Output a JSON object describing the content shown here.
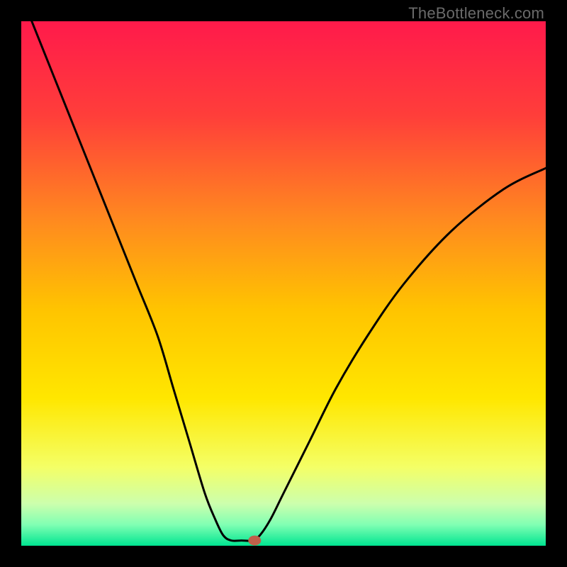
{
  "watermark": "TheBottleneck.com",
  "chart_data": {
    "type": "line",
    "title": "",
    "xlabel": "",
    "ylabel": "",
    "xlim": [
      0,
      100
    ],
    "ylim": [
      0,
      100
    ],
    "legend": false,
    "grid": false,
    "background_gradient_stops": [
      {
        "offset": 0.0,
        "color": "#ff1a4b"
      },
      {
        "offset": 0.18,
        "color": "#ff3e3a"
      },
      {
        "offset": 0.38,
        "color": "#ff8a1f"
      },
      {
        "offset": 0.55,
        "color": "#ffc400"
      },
      {
        "offset": 0.72,
        "color": "#ffe700"
      },
      {
        "offset": 0.85,
        "color": "#f4ff66"
      },
      {
        "offset": 0.92,
        "color": "#ccffad"
      },
      {
        "offset": 0.96,
        "color": "#80ffb3"
      },
      {
        "offset": 1.0,
        "color": "#00e591"
      }
    ],
    "curve_points": [
      {
        "x": 2.0,
        "y": 100.0
      },
      {
        "x": 6.0,
        "y": 90.0
      },
      {
        "x": 10.0,
        "y": 80.0
      },
      {
        "x": 14.0,
        "y": 70.0
      },
      {
        "x": 18.0,
        "y": 60.0
      },
      {
        "x": 22.0,
        "y": 50.0
      },
      {
        "x": 26.0,
        "y": 40.0
      },
      {
        "x": 29.0,
        "y": 30.0
      },
      {
        "x": 32.0,
        "y": 20.0
      },
      {
        "x": 35.0,
        "y": 10.0
      },
      {
        "x": 37.0,
        "y": 5.0
      },
      {
        "x": 38.5,
        "y": 2.0
      },
      {
        "x": 40.0,
        "y": 1.0
      },
      {
        "x": 42.0,
        "y": 1.0
      },
      {
        "x": 44.0,
        "y": 1.0
      },
      {
        "x": 45.5,
        "y": 2.0
      },
      {
        "x": 47.5,
        "y": 5.0
      },
      {
        "x": 50.0,
        "y": 10.0
      },
      {
        "x": 55.0,
        "y": 20.0
      },
      {
        "x": 60.0,
        "y": 30.0
      },
      {
        "x": 66.0,
        "y": 40.0
      },
      {
        "x": 73.0,
        "y": 50.0
      },
      {
        "x": 82.0,
        "y": 60.0
      },
      {
        "x": 92.0,
        "y": 68.0
      },
      {
        "x": 100.0,
        "y": 72.0
      }
    ],
    "marker": {
      "x": 44.5,
      "y": 1.0,
      "color": "#c0604a"
    },
    "curve_color": "#000000",
    "curve_width": 3
  }
}
